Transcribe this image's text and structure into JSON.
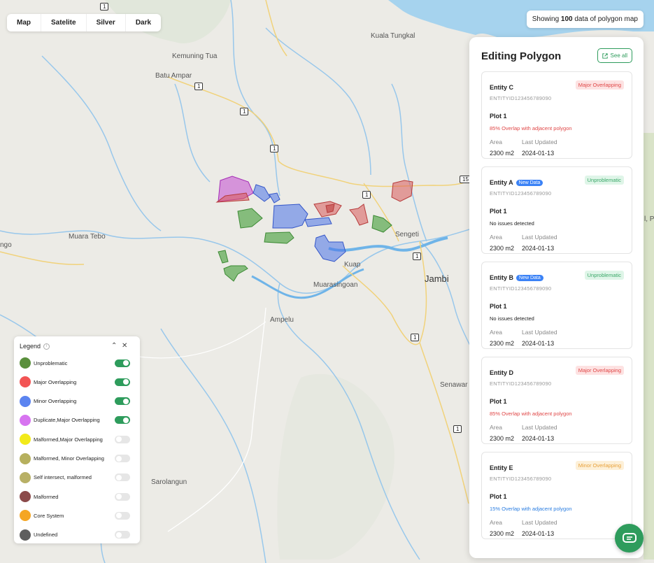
{
  "map_styles": [
    "Map",
    "Satelite",
    "Silver",
    "Dark"
  ],
  "count_pill": {
    "prefix": "Showing ",
    "count": "100",
    "suffix": " data of polygon map"
  },
  "map_labels": [
    "Kuala Tungkal",
    "Kemuning Tua",
    "Batu Ampar",
    "Muara Tebo",
    "ngo",
    "Sengeti",
    "Kuap",
    "Muarasingoan",
    "Jambi",
    "Ampelu",
    "Senawar J",
    "Sarolangun",
    "l, Pa"
  ],
  "road_badges": [
    "1",
    "1",
    "1",
    "1",
    "1",
    "1",
    "1",
    "15",
    "1",
    "1"
  ],
  "panel": {
    "title": "Editing Polygon",
    "see_all": "See all",
    "cards": [
      {
        "entity": "Entity C",
        "new_badge": "",
        "status": "Major Overlapping",
        "status_kind": "major",
        "id": "ENTITYID123456789090",
        "plot": "Plot 1",
        "desc": "85% Overlap with adjacent polygon",
        "desc_kind": "red",
        "area_label": "Area",
        "area": "2300 m2",
        "updated_label": "Last Updated",
        "updated": "2024-01-13"
      },
      {
        "entity": "Entity A",
        "new_badge": "New Data",
        "status": "Unproblematic",
        "status_kind": "unprob",
        "id": "ENTITYID123456789090",
        "plot": "Plot 1",
        "desc": "No issues detected",
        "desc_kind": "plain",
        "area_label": "Area",
        "area": "2300 m2",
        "updated_label": "Last Updated",
        "updated": "2024-01-13"
      },
      {
        "entity": "Entity B",
        "new_badge": "New Data",
        "status": "Unproblematic",
        "status_kind": "unprob",
        "id": "ENTITYID123456789090",
        "plot": "Plot 1",
        "desc": "No issues detected",
        "desc_kind": "plain",
        "area_label": "Area",
        "area": "2300 m2",
        "updated_label": "Last Updated",
        "updated": "2024-01-13"
      },
      {
        "entity": "Entity D",
        "new_badge": "",
        "status": "Major Overlapping",
        "status_kind": "major",
        "id": "ENTITYID123456789090",
        "plot": "Plot 1",
        "desc": "85% Overlap with adjacent polygon",
        "desc_kind": "red",
        "area_label": "Area",
        "area": "2300 m2",
        "updated_label": "Last Updated",
        "updated": "2024-01-13"
      },
      {
        "entity": "Entity E",
        "new_badge": "",
        "status": "Minor Overlapping",
        "status_kind": "minor",
        "id": "ENTITYID123456789090",
        "plot": "Plot 1",
        "desc": "15% Overlap with adjacent polygon",
        "desc_kind": "blue",
        "area_label": "Area",
        "area": "2300 m2",
        "updated_label": "Last Updated",
        "updated": "2024-01-13"
      }
    ]
  },
  "legend": {
    "title": "Legend",
    "items": [
      {
        "label": "Unproblematic",
        "color": "#5a8f3c",
        "on": true
      },
      {
        "label": "Major Overlapping",
        "color": "#f25454",
        "on": true
      },
      {
        "label": "Minor Overlapping",
        "color": "#5b84f0",
        "on": true
      },
      {
        "label": "Duplicate,Major Overlapping",
        "color": "#d774f0",
        "on": true
      },
      {
        "label": "Malformed,Major Overlapping",
        "color": "#f2ea1a",
        "on": false
      },
      {
        "label": "Malformed, Minor Overlapping",
        "color": "#b6b05e",
        "on": false
      },
      {
        "label": "Self intersect, malformed",
        "color": "#b8b066",
        "on": false
      },
      {
        "label": "Malformed",
        "color": "#8b4a4a",
        "on": false
      },
      {
        "label": "Core System",
        "color": "#f5a623",
        "on": false
      },
      {
        "label": "Undefined",
        "color": "#5e5e5e",
        "on": false
      }
    ]
  },
  "polygon_colors": {
    "unproblematic": "#5aa84e",
    "major": "#c94a52",
    "minor": "#4a72e8",
    "duplicate": "#c24ad0"
  }
}
